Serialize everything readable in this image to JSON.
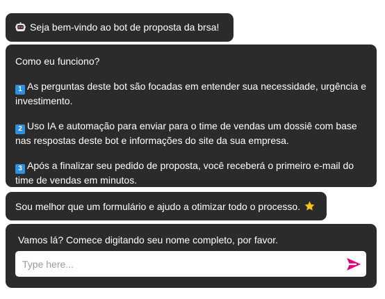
{
  "messages": {
    "welcome": {
      "icon": "robot-icon",
      "text": "Seja bem-vindo ao bot de proposta da brsa!"
    },
    "how_it_works": {
      "heading": "Como eu funciono?",
      "points": [
        {
          "badge": "1",
          "text": "As perguntas deste bot são focadas em entender sua necessidade, urgência e investimento."
        },
        {
          "badge": "2",
          "text": "Uso IA e automação para enviar para o time de vendas um dossiê com base nas respostas deste bot e informações do site da sua empresa."
        },
        {
          "badge": "3",
          "text": "Após a finalizar seu pedido de proposta, você receberá o primeiro e-mail do time de vendas em minutos."
        }
      ]
    },
    "better_than_form": {
      "text": "Sou melhor que um formulário e ajudo a otimizar todo o processo.",
      "icon": "star-icon"
    },
    "prompt": {
      "text": "Vamos lá? Comece digitando seu nome completo, por favor."
    }
  },
  "composer": {
    "placeholder": "Type here...",
    "value": "",
    "send_icon": "send-icon"
  },
  "colors": {
    "bubble_bg": "#2b2b2b",
    "bubble_text": "#ffffff",
    "send_accent": "#e6007e",
    "keycap_blue": "#2f8fe0",
    "star_yellow": "#f7c325"
  }
}
